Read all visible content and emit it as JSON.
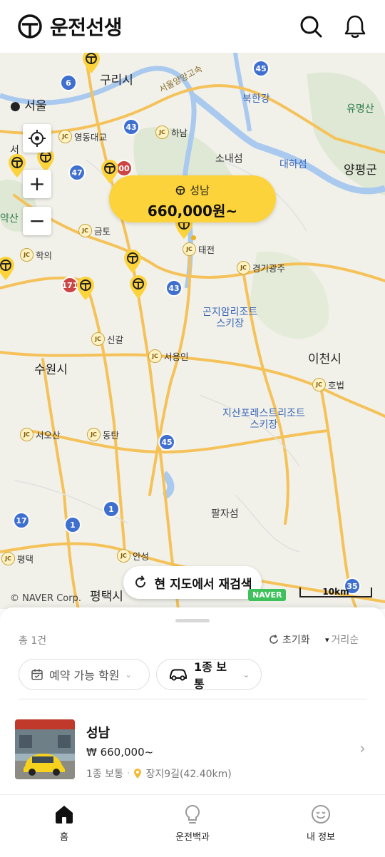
{
  "header": {
    "title": "운전선생"
  },
  "map": {
    "places": {
      "guri": "구리시",
      "seoul": "서울",
      "bukhangang": "북한강",
      "yumyeongsan": "유명산",
      "hanam": "하남",
      "sonaeseom": "소내섬",
      "daehaseom": "대하섬",
      "yangpyeong": "양평군",
      "yaksan": "약산",
      "geumto": "금토",
      "hakui": "학의",
      "taejeon": "태전",
      "gyeonggigwangju": "경기광주",
      "gonjiam": "곤지암리조트\n스키장",
      "singal": "신갈",
      "seoyongin": "서용인",
      "icheon": "이천시",
      "suwon": "수원시",
      "hobeop": "호법",
      "jisan": "지산포레스트리조트\n스키장",
      "seoosan": "서오산",
      "dongtan": "동탄",
      "paljaseom": "팔자섬",
      "pyeongtaek_jc": "평택",
      "anseong": "안성",
      "pyeongtaek": "평택시",
      "yeongdong": "영동대교",
      "expressway": "서울양양고속",
      "seo_frag": "서"
    },
    "shields": [
      "6",
      "45",
      "43",
      "47",
      "00",
      "171",
      "43",
      "45",
      "1",
      "17",
      "1",
      "35"
    ],
    "callout": {
      "name": "성남",
      "price": "660,000원~"
    },
    "research_label": "현 지도에서 재검색",
    "credit": "© NAVER Corp.",
    "naver_badge": "NAVER",
    "scale_label": "10km"
  },
  "sheet": {
    "count": "총 1건",
    "reset": "초기화",
    "sort": "거리순",
    "filter_academy": "예약 가능 학원",
    "filter_license": "1종 보통",
    "result": {
      "name": "성남",
      "price": "₩ 660,000~",
      "license": "1종 보통",
      "location": "장지9길(42.40km)"
    }
  },
  "nav": {
    "home": "홈",
    "encyclopedia": "운전백과",
    "profile": "내 정보"
  },
  "colors": {
    "accent": "#fdd33b",
    "road": "#f5c25a",
    "water": "#a9c9ef",
    "shield": "#3f6fcf"
  }
}
